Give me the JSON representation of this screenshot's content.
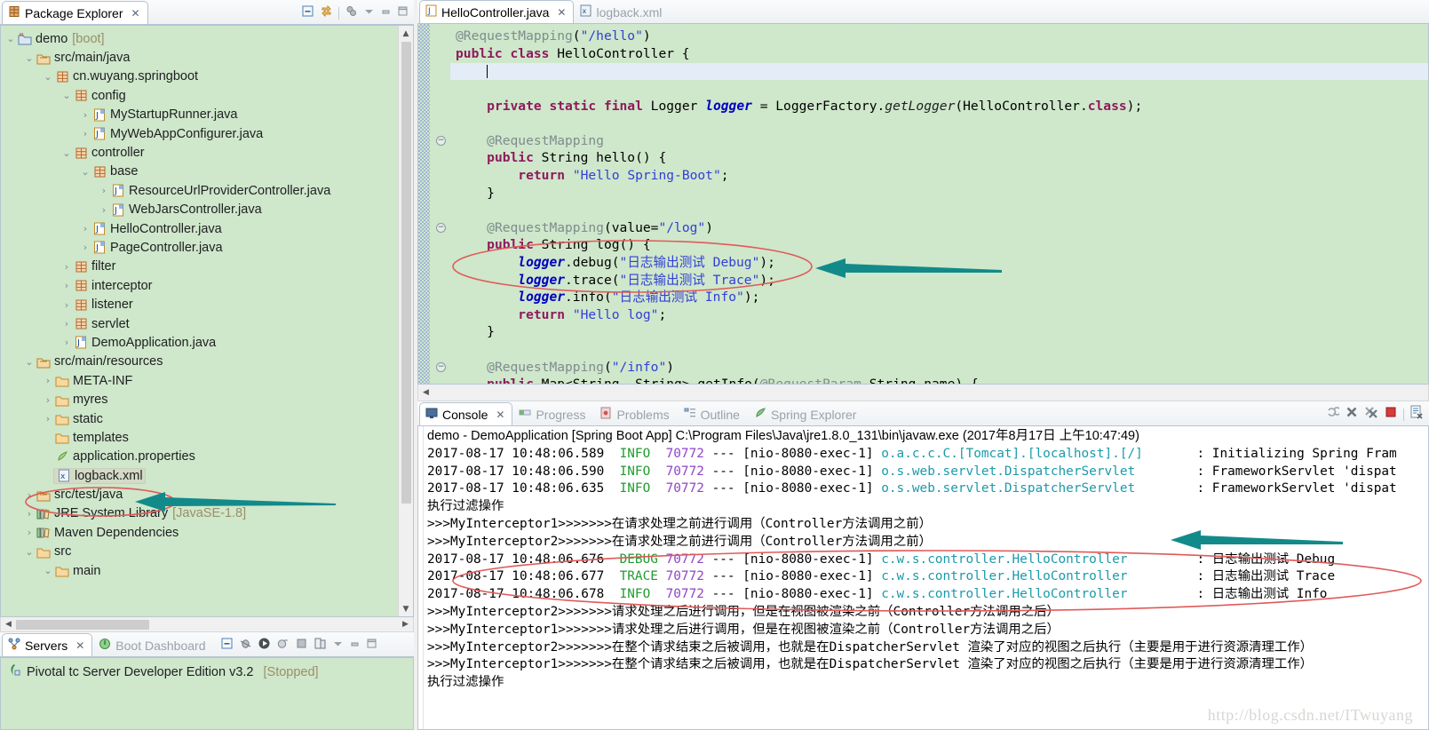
{
  "package_explorer": {
    "tab_label": "Package Explorer",
    "close_glyph": "✕",
    "toolbar_icons": [
      "collapse-all-icon",
      "link-with-editor-icon",
      "focus-icon",
      "view-menu-icon",
      "minimize-icon",
      "maximize-icon"
    ],
    "tree": [
      {
        "indent": 0,
        "twisty": "v",
        "icon": "project-icon",
        "label": "demo",
        "suffix": "[boot]"
      },
      {
        "indent": 1,
        "twisty": "v",
        "icon": "source-folder-icon",
        "label": "src/main/java",
        "suffix": ""
      },
      {
        "indent": 2,
        "twisty": "v",
        "icon": "package-icon",
        "label": "cn.wuyang.springboot",
        "suffix": ""
      },
      {
        "indent": 3,
        "twisty": "v",
        "icon": "package-icon",
        "label": "config",
        "suffix": ""
      },
      {
        "indent": 4,
        "twisty": ">",
        "icon": "java-file-icon",
        "label": "MyStartupRunner.java",
        "suffix": ""
      },
      {
        "indent": 4,
        "twisty": ">",
        "icon": "java-file-icon",
        "label": "MyWebAppConfigurer.java",
        "suffix": ""
      },
      {
        "indent": 3,
        "twisty": "v",
        "icon": "package-icon",
        "label": "controller",
        "suffix": ""
      },
      {
        "indent": 4,
        "twisty": "v",
        "icon": "package-icon",
        "label": "base",
        "suffix": ""
      },
      {
        "indent": 5,
        "twisty": ">",
        "icon": "java-file-icon",
        "label": "ResourceUrlProviderController.java",
        "suffix": ""
      },
      {
        "indent": 5,
        "twisty": ">",
        "icon": "java-file-icon",
        "label": "WebJarsController.java",
        "suffix": ""
      },
      {
        "indent": 4,
        "twisty": ">",
        "icon": "java-file-icon",
        "label": "HelloController.java",
        "suffix": ""
      },
      {
        "indent": 4,
        "twisty": ">",
        "icon": "java-file-icon",
        "label": "PageController.java",
        "suffix": ""
      },
      {
        "indent": 3,
        "twisty": ">",
        "icon": "package-icon",
        "label": "filter",
        "suffix": ""
      },
      {
        "indent": 3,
        "twisty": ">",
        "icon": "package-icon",
        "label": "interceptor",
        "suffix": ""
      },
      {
        "indent": 3,
        "twisty": ">",
        "icon": "package-icon",
        "label": "listener",
        "suffix": ""
      },
      {
        "indent": 3,
        "twisty": ">",
        "icon": "package-icon",
        "label": "servlet",
        "suffix": ""
      },
      {
        "indent": 3,
        "twisty": ">",
        "icon": "java-file-icon",
        "label": "DemoApplication.java",
        "suffix": ""
      },
      {
        "indent": 1,
        "twisty": "v",
        "icon": "source-folder-icon",
        "label": "src/main/resources",
        "suffix": ""
      },
      {
        "indent": 2,
        "twisty": ">",
        "icon": "folder-icon",
        "label": "META-INF",
        "suffix": ""
      },
      {
        "indent": 2,
        "twisty": ">",
        "icon": "folder-icon",
        "label": "myres",
        "suffix": ""
      },
      {
        "indent": 2,
        "twisty": ">",
        "icon": "folder-icon",
        "label": "static",
        "suffix": ""
      },
      {
        "indent": 2,
        "twisty": "",
        "icon": "folder-icon",
        "label": "templates",
        "suffix": ""
      },
      {
        "indent": 2,
        "twisty": "",
        "icon": "properties-file-icon",
        "label": "application.properties",
        "suffix": ""
      },
      {
        "indent": 2,
        "twisty": "",
        "icon": "xml-file-icon",
        "label": "logback.xml",
        "suffix": "",
        "selected": true
      },
      {
        "indent": 1,
        "twisty": ">",
        "icon": "source-folder-icon",
        "label": "src/test/java",
        "suffix": ""
      },
      {
        "indent": 1,
        "twisty": ">",
        "icon": "library-icon",
        "label": "JRE System Library",
        "suffix": "[JavaSE-1.8]"
      },
      {
        "indent": 1,
        "twisty": ">",
        "icon": "library-icon",
        "label": "Maven Dependencies",
        "suffix": ""
      },
      {
        "indent": 1,
        "twisty": "v",
        "icon": "folder-icon",
        "label": "src",
        "suffix": ""
      },
      {
        "indent": 2,
        "twisty": "v",
        "icon": "folder-icon",
        "label": "main",
        "suffix": ""
      }
    ]
  },
  "servers_view": {
    "tabs": [
      {
        "label": "Servers",
        "icon": "servers-icon",
        "active": true
      },
      {
        "label": "Boot Dashboard",
        "icon": "boot-dashboard-icon",
        "active": false
      }
    ],
    "close_glyph": "✕",
    "toolbar_icons": [
      "collapse-all-icon",
      "debug-icon",
      "start-icon",
      "profile-icon",
      "stop-icon",
      "publish-icon",
      "view-menu-icon",
      "minimize-icon",
      "maximize-icon"
    ],
    "rows": [
      {
        "icon": "pivotal-server-icon",
        "label": "Pivotal tc Server Developer Edition v3.2",
        "status": "[Stopped]"
      }
    ]
  },
  "editor": {
    "tabs": [
      {
        "label": "HelloController.java",
        "icon": "java-file-icon",
        "active": true
      },
      {
        "label": "logback.xml",
        "icon": "xml-file-icon",
        "active": false
      }
    ],
    "close_glyph": "✕",
    "lines": [
      {
        "fold": false,
        "cur": false,
        "html": "<span class=\"ann\">@RequestMapping</span>(<span class=\"str\">\"/hello\"</span>)"
      },
      {
        "fold": false,
        "cur": false,
        "html": "<span class=\"kw\">public class</span> HelloController {"
      },
      {
        "fold": false,
        "cur": true,
        "html": "    <span class=\"caret\"></span>"
      },
      {
        "fold": false,
        "cur": false,
        "html": ""
      },
      {
        "fold": false,
        "cur": false,
        "html": "    <span class=\"kw\">private static final</span> Logger <span class=\"fld\">logger</span> = LoggerFactory.<span class=\"mth\">getLogger</span>(HelloController.<span class=\"kw\">class</span>);"
      },
      {
        "fold": false,
        "cur": false,
        "html": ""
      },
      {
        "fold": true,
        "cur": false,
        "html": "    <span class=\"ann\">@RequestMapping</span>"
      },
      {
        "fold": false,
        "cur": false,
        "html": "    <span class=\"kw\">public</span> String hello() {"
      },
      {
        "fold": false,
        "cur": false,
        "html": "        <span class=\"kw\">return</span> <span class=\"str\">\"Hello Spring-Boot\"</span>;"
      },
      {
        "fold": false,
        "cur": false,
        "html": "    }"
      },
      {
        "fold": false,
        "cur": false,
        "html": ""
      },
      {
        "fold": true,
        "cur": false,
        "html": "    <span class=\"ann\">@RequestMapping</span>(value=<span class=\"str\">\"/log\"</span>)"
      },
      {
        "fold": false,
        "cur": false,
        "html": "    <span class=\"kw\">public</span> String log() {"
      },
      {
        "fold": false,
        "cur": false,
        "html": "        <span class=\"fld\">logger</span>.debug(<span class=\"str\">\"日志输出测试 Debug\"</span>);"
      },
      {
        "fold": false,
        "cur": false,
        "html": "        <span class=\"fld\">logger</span>.trace(<span class=\"str\">\"日志输出测试 Trace\"</span>);"
      },
      {
        "fold": false,
        "cur": false,
        "html": "        <span class=\"fld\">logger</span>.info(<span class=\"str\">\"日志输出测试 Info\"</span>);"
      },
      {
        "fold": false,
        "cur": false,
        "html": "        <span class=\"kw\">return</span> <span class=\"str\">\"Hello log\"</span>;"
      },
      {
        "fold": false,
        "cur": false,
        "html": "    }"
      },
      {
        "fold": false,
        "cur": false,
        "html": ""
      },
      {
        "fold": true,
        "cur": false,
        "html": "    <span class=\"ann\">@RequestMapping</span>(<span class=\"str\">\"/info\"</span>)"
      },
      {
        "fold": false,
        "cur": false,
        "html": "    <span class=\"kw\">public</span> Map&lt;String, String&gt; getInfo(<span class=\"ann\">@RequestParam</span> String name) {"
      }
    ]
  },
  "console": {
    "tabs": [
      {
        "label": "Console",
        "icon": "console-icon",
        "active": true
      },
      {
        "label": "Progress",
        "icon": "progress-icon",
        "active": false
      },
      {
        "label": "Problems",
        "icon": "problems-icon",
        "active": false
      },
      {
        "label": "Outline",
        "icon": "outline-icon",
        "active": false
      },
      {
        "label": "Spring Explorer",
        "icon": "spring-explorer-icon",
        "active": false
      }
    ],
    "close_glyph": "✕",
    "toolbar_icons": [
      "relaunch-icon",
      "terminate-icon",
      "remove-all-terminated-icon",
      "stop-icon",
      "clear-console-icon"
    ],
    "launch_title": "demo - DemoApplication [Spring Boot App] C:\\Program Files\\Java\\jre1.8.0_131\\bin\\javaw.exe (2017年8月17日 上午10:47:49)",
    "lines": [
      {
        "type": "log",
        "ts": "2017-08-17 10:48:06.589",
        "level": "INFO",
        "pid": "70772",
        "thread": "[nio-8080-exec-1]",
        "logger": "o.a.c.c.C.[Tomcat].[localhost].[/]",
        "msg": "Initializing Spring Fram"
      },
      {
        "type": "log",
        "ts": "2017-08-17 10:48:06.590",
        "level": "INFO",
        "pid": "70772",
        "thread": "[nio-8080-exec-1]",
        "logger": "o.s.web.servlet.DispatcherServlet",
        "msg": "FrameworkServlet 'dispat"
      },
      {
        "type": "log",
        "ts": "2017-08-17 10:48:06.635",
        "level": "INFO",
        "pid": "70772",
        "thread": "[nio-8080-exec-1]",
        "logger": "o.s.web.servlet.DispatcherServlet",
        "msg": "FrameworkServlet 'dispat"
      },
      {
        "type": "plain",
        "text": "执行过滤操作"
      },
      {
        "type": "plain",
        "text": ">>>MyInterceptor1>>>>>>>在请求处理之前进行调用（Controller方法调用之前）"
      },
      {
        "type": "plain",
        "text": ">>>MyInterceptor2>>>>>>>在请求处理之前进行调用（Controller方法调用之前）"
      },
      {
        "type": "log",
        "ts": "2017-08-17 10:48:06.676",
        "level": "DEBUG",
        "pid": "70772",
        "thread": "[nio-8080-exec-1]",
        "logger": "c.w.s.controller.HelloController",
        "msg": "日志输出测试 Debug"
      },
      {
        "type": "log",
        "ts": "2017-08-17 10:48:06.677",
        "level": "TRACE",
        "pid": "70772",
        "thread": "[nio-8080-exec-1]",
        "logger": "c.w.s.controller.HelloController",
        "msg": "日志输出测试 Trace"
      },
      {
        "type": "log",
        "ts": "2017-08-17 10:48:06.678",
        "level": "INFO",
        "pid": "70772",
        "thread": "[nio-8080-exec-1]",
        "logger": "c.w.s.controller.HelloController",
        "msg": "日志输出测试 Info"
      },
      {
        "type": "plain",
        "text": ">>>MyInterceptor2>>>>>>>请求处理之后进行调用，但是在视图被渲染之前（Controller方法调用之后）"
      },
      {
        "type": "plain",
        "text": ">>>MyInterceptor1>>>>>>>请求处理之后进行调用，但是在视图被渲染之前（Controller方法调用之后）"
      },
      {
        "type": "plain",
        "text": ">>>MyInterceptor2>>>>>>>在整个请求结束之后被调用，也就是在DispatcherServlet 渲染了对应的视图之后执行（主要是用于进行资源清理工作）"
      },
      {
        "type": "plain",
        "text": ">>>MyInterceptor1>>>>>>>在整个请求结束之后被调用，也就是在DispatcherServlet 渲染了对应的视图之后执行（主要是用于进行资源清理工作）"
      },
      {
        "type": "plain",
        "text": "执行过滤操作"
      }
    ]
  },
  "annotations": {
    "ellipse_color": "#e05a5a",
    "arrow_color": "#138a8a",
    "watermark": "http://blog.csdn.net/ITwuyang"
  }
}
